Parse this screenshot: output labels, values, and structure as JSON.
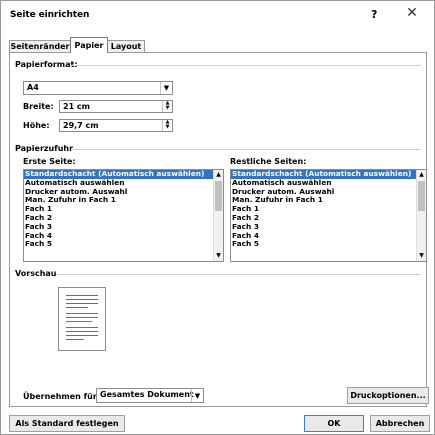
{
  "window": {
    "title": "Seite einrichten",
    "help_label": "?",
    "close_label": "✕"
  },
  "tabs": [
    {
      "label": "Seitenränder",
      "active": false
    },
    {
      "label": "Papier",
      "active": true
    },
    {
      "label": "Layout",
      "active": false
    }
  ],
  "paper_format": {
    "section_label": "Papierformat:",
    "format_value": "A4",
    "width_label": "Breite:",
    "width_value": "21 cm",
    "height_label": "Höhe:",
    "height_value": "29,7 cm"
  },
  "paper_feed": {
    "section_label": "Papierzufuhr",
    "first_page_label": "Erste Seite:",
    "other_pages_label": "Restliche Seiten:",
    "items": [
      "Standardschacht (Automatisch auswählen)",
      "Automatisch auswählen",
      "Drucker autom. Auswahl",
      "Man. Zufuhr in Fach 1",
      "Fach 1",
      "Fach 2",
      "Fach 3",
      "Fach 4",
      "Fach 5"
    ],
    "first_page_selected": "Standardschacht (Automatisch auswählen)",
    "other_pages_selected": "Standardschacht (Automatisch auswählen)"
  },
  "preview": {
    "section_label": "Vorschau"
  },
  "apply": {
    "label": "Übernehmen für:",
    "value": "Gesamtes Dokument",
    "print_options_label": "Druckoptionen..."
  },
  "footer": {
    "default_label": "Als Standard festlegen",
    "ok_label": "OK",
    "cancel_label": "Abbrechen"
  },
  "colors": {
    "selection": "#3373c4",
    "ok_border": "#3c7fd6"
  }
}
